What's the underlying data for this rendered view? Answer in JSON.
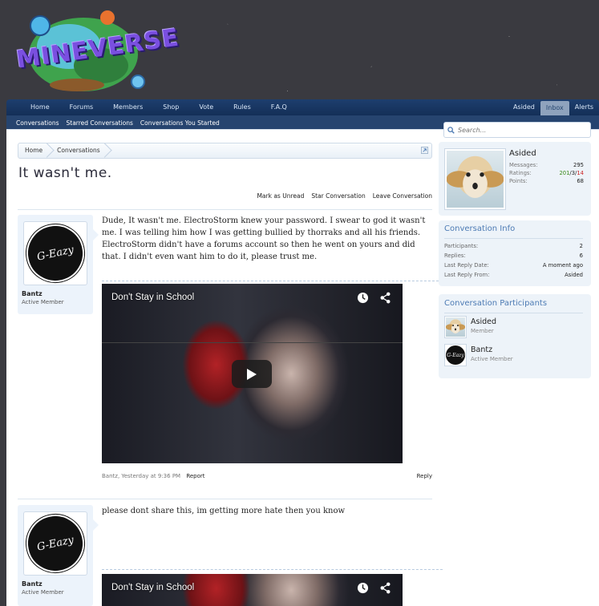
{
  "brand": {
    "logo_text": "MINEVERSE"
  },
  "nav": {
    "items": [
      "Home",
      "Forums",
      "Members",
      "Shop",
      "Vote",
      "Rules",
      "F.A.Q"
    ],
    "right": [
      "Asided",
      "Inbox",
      "Alerts"
    ]
  },
  "subnav": {
    "items": [
      "Conversations",
      "Starred Conversations",
      "Conversations You Started"
    ]
  },
  "search": {
    "placeholder": "Search..."
  },
  "breadcrumb": [
    "Home",
    "Conversations"
  ],
  "page": {
    "title": "It wasn't me.",
    "actions": [
      "Mark as Unread",
      "Star Conversation",
      "Leave Conversation"
    ]
  },
  "messages": [
    {
      "username": "Bantz",
      "user_title": "Active Member",
      "avatar_text": "G-Eazy",
      "text": "Dude, It wasn't me. ElectroStorm knew your password. I swear to god it wasn't me. I was telling him how I was getting bullied by thorraks and all his friends. ElectroStorm didn't have a forums account so then he went on yours and did that. I didn't even want him to do it, please trust me.",
      "video_title": "Don't Stay in School",
      "meta_author": "Bantz",
      "meta_time": "Yesterday at 9:36 PM",
      "report_label": "Report",
      "reply_label": "Reply"
    },
    {
      "username": "Bantz",
      "user_title": "Active Member",
      "avatar_text": "G-Eazy",
      "text": "please dont share this, im getting more hate then you know",
      "video_title": "Don't Stay in School"
    }
  ],
  "visitor": {
    "name": "Asided",
    "stats": [
      {
        "label": "Messages:",
        "value": "295"
      },
      {
        "label": "Ratings:",
        "positive": "201",
        "neutral": "3",
        "negative": "14"
      },
      {
        "label": "Points:",
        "value": "68"
      }
    ]
  },
  "conversation_info": {
    "heading": "Conversation Info",
    "rows": [
      {
        "label": "Participants:",
        "value": "2"
      },
      {
        "label": "Replies:",
        "value": "6"
      },
      {
        "label": "Last Reply Date:",
        "value": "A moment ago"
      },
      {
        "label": "Last Reply From:",
        "value": "Asided"
      }
    ]
  },
  "participants": {
    "heading": "Conversation Participants",
    "list": [
      {
        "name": "Asided",
        "title": "Member"
      },
      {
        "name": "Bantz",
        "title": "Active Member"
      }
    ]
  },
  "colors": {
    "nav_bg": "#1d3e6e",
    "accent": "#4d7bb4",
    "positive": "#3a8a1c",
    "negative": "#cc2222"
  }
}
